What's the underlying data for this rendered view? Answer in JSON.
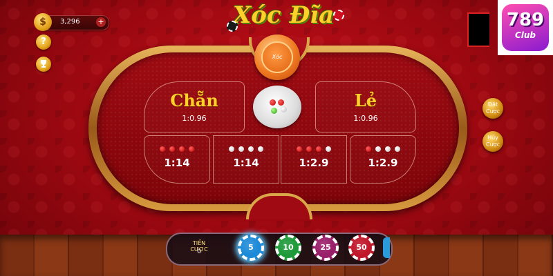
{
  "header": {
    "coin_symbol": "$",
    "coin_balance": "3,296",
    "add_coin": "+",
    "help_label": "?",
    "leaderboard_icon": "trophy-icon",
    "title": "Xóc Đĩa"
  },
  "logo": {
    "main": "789",
    "sub": "Club"
  },
  "table": {
    "bowl_label": "Xóc",
    "even": {
      "label": "Chẵn",
      "odds": "1:0.96"
    },
    "odd": {
      "label": "Lẻ",
      "odds": "1:0.96"
    },
    "cells": [
      {
        "dots": [
          "red",
          "red",
          "red",
          "red"
        ],
        "odds": "1:14"
      },
      {
        "dots": [
          "white",
          "white",
          "white",
          "white"
        ],
        "odds": "1:14"
      },
      {
        "dots": [
          "red",
          "red",
          "red",
          "white"
        ],
        "odds": "1:2.9"
      },
      {
        "dots": [
          "red",
          "white",
          "white",
          "white"
        ],
        "odds": "1:2.9"
      }
    ]
  },
  "side_buttons": {
    "rebet": "Đặt\nCược",
    "cancel": "Hủy\nCược"
  },
  "chip_bar": {
    "stake_label": "TIỀN CƯỢC",
    "stake_value": "0",
    "chips": [
      {
        "value": "5",
        "color": "#1d8ad8",
        "selected": true
      },
      {
        "value": "10",
        "color": "#1f9a3a",
        "selected": false
      },
      {
        "value": "25",
        "color": "#9a1f6a",
        "selected": false
      },
      {
        "value": "50",
        "color": "#c0182a",
        "selected": false
      }
    ]
  },
  "colors": {
    "felt": "#9e0b12",
    "rim": "#d9a64a",
    "accent_gold": "#ffcf2a"
  }
}
